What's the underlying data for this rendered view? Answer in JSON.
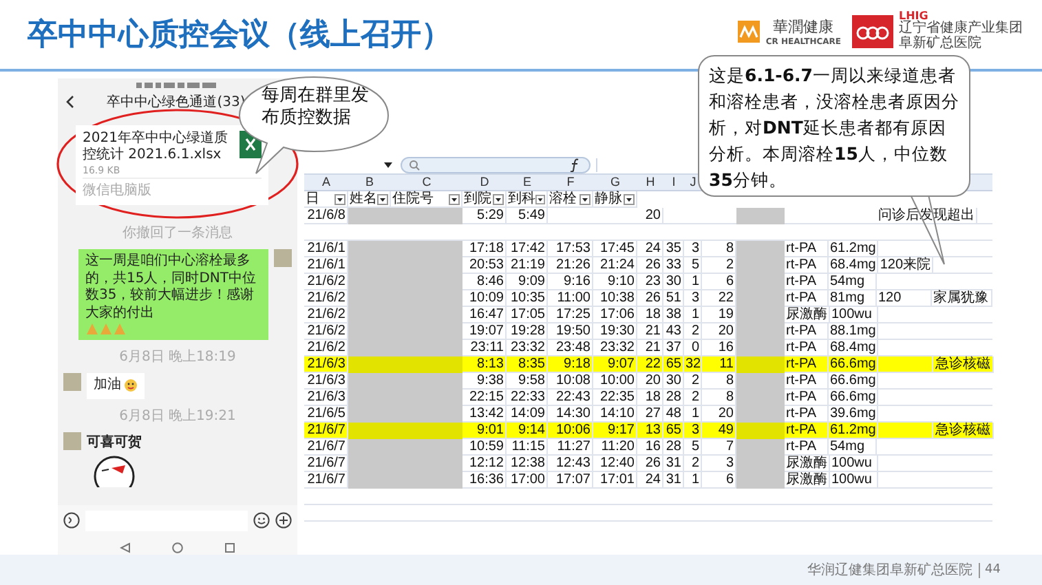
{
  "title": "卒中中心质控会议（线上召开）",
  "logos": {
    "cr": {
      "name": "華潤健康",
      "subtitle": "CR HEALTHCARE"
    },
    "lhig": {
      "abbr": "LHIG",
      "group": "辽宁省健康产业集团",
      "hospital": "阜新矿总医院"
    }
  },
  "phone": {
    "chat_title": "卒中中心绿色通道(33)",
    "messages": [
      {
        "kind": "file",
        "name": "2021年卒中中心绿道质控统计 2021.6.1.xlsx",
        "size": "16.9 KB",
        "source": "微信电脑版"
      },
      {
        "kind": "notice",
        "text": "你撤回了一条消息"
      },
      {
        "kind": "outgoing",
        "text": "这一周是咱们中心溶栓最多的，共15人，同时DNT中位数35，较前大幅进步！感谢大家的付出"
      },
      {
        "kind": "notice",
        "text": "6月8日 晚上18:19"
      },
      {
        "kind": "incoming",
        "text": "加油"
      },
      {
        "kind": "notice",
        "text": "6月8日 晚上19:21"
      },
      {
        "kind": "sticker",
        "text": "可喜可贺"
      }
    ]
  },
  "callouts": [
    {
      "text": "每周在群里发布质控数据"
    },
    {
      "text": "这是**6.1-6.7**一周以来绿道患者和溶栓患者，没溶栓患者原因分析，对**DNT**延长患者都有原因分析。本周溶栓**15**人，中位数**35**分钟。"
    }
  ],
  "sheet": {
    "columns": [
      {
        "letter": "A",
        "header": "日",
        "kind": "date"
      },
      {
        "letter": "B",
        "header": "姓名",
        "kind": "redacted"
      },
      {
        "letter": "C",
        "header": "住院号",
        "kind": "redacted"
      },
      {
        "letter": "D",
        "header": "到院",
        "kind": "number"
      },
      {
        "letter": "E",
        "header": "到科",
        "kind": "number"
      },
      {
        "letter": "F",
        "header": "溶栓",
        "kind": "number"
      },
      {
        "letter": "G",
        "header": "静脉",
        "kind": "number"
      },
      {
        "letter": "H",
        "kind": "number"
      },
      {
        "letter": "I",
        "kind": "number"
      },
      {
        "letter": "J",
        "kind": "number"
      },
      {
        "kind": "number"
      },
      {
        "kind": "redacted"
      },
      {
        "kind": "text"
      },
      {
        "kind": "text"
      },
      {
        "kind": "text"
      },
      {
        "kind": "text"
      }
    ],
    "rows": [
      {
        "highlighted": false,
        "cells": [
          "21/6/8",
          "",
          "",
          "5:29",
          "5:49",
          "",
          "",
          "20",
          "",
          "",
          "",
          "",
          "",
          "",
          "问诊后发现超出",
          ""
        ]
      },
      {
        "highlighted": false,
        "cells": [
          "21/6/1",
          "",
          "",
          "17:18",
          "17:42",
          "17:53",
          "17:45",
          "24",
          "35",
          "3",
          "8",
          "",
          "rt-PA",
          "61.2mg",
          "",
          ""
        ]
      },
      {
        "highlighted": false,
        "cells": [
          "21/6/1",
          "",
          "",
          "20:53",
          "21:19",
          "21:26",
          "21:24",
          "26",
          "33",
          "5",
          "2",
          "",
          "rt-PA",
          "68.4mg",
          "120来院",
          ""
        ]
      },
      {
        "highlighted": false,
        "cells": [
          "21/6/2",
          "",
          "",
          "8:46",
          "9:09",
          "9:16",
          "9:10",
          "23",
          "30",
          "1",
          "6",
          "",
          "rt-PA",
          "54mg",
          "",
          ""
        ]
      },
      {
        "highlighted": false,
        "cells": [
          "21/6/2",
          "",
          "",
          "10:09",
          "10:35",
          "11:00",
          "10:38",
          "26",
          "51",
          "3",
          "22",
          "",
          "rt-PA",
          "81mg",
          "120",
          "家属犹豫"
        ]
      },
      {
        "highlighted": false,
        "cells": [
          "21/6/2",
          "",
          "",
          "16:47",
          "17:05",
          "17:25",
          "17:06",
          "18",
          "38",
          "1",
          "19",
          "",
          "尿激酶",
          "100wu",
          "",
          ""
        ]
      },
      {
        "highlighted": false,
        "cells": [
          "21/6/2",
          "",
          "",
          "19:07",
          "19:28",
          "19:50",
          "19:30",
          "21",
          "43",
          "2",
          "20",
          "",
          "rt-PA",
          "88.1mg",
          "",
          ""
        ]
      },
      {
        "highlighted": false,
        "cells": [
          "21/6/2",
          "",
          "",
          "23:11",
          "23:32",
          "23:48",
          "23:32",
          "21",
          "37",
          "0",
          "16",
          "",
          "rt-PA",
          "68.4mg",
          "",
          ""
        ]
      },
      {
        "highlighted": true,
        "cells": [
          "21/6/3",
          "",
          "",
          "8:13",
          "8:35",
          "9:18",
          "9:07",
          "22",
          "65",
          "32",
          "11",
          "",
          "rt-PA",
          "66.6mg",
          "",
          "急诊核磁"
        ]
      },
      {
        "highlighted": false,
        "cells": [
          "21/6/3",
          "",
          "",
          "9:38",
          "9:58",
          "10:08",
          "10:00",
          "20",
          "30",
          "2",
          "8",
          "",
          "rt-PA",
          "66.6mg",
          "",
          ""
        ]
      },
      {
        "highlighted": false,
        "cells": [
          "21/6/3",
          "",
          "",
          "22:15",
          "22:33",
          "22:43",
          "22:35",
          "18",
          "28",
          "2",
          "8",
          "",
          "rt-PA",
          "66.6mg",
          "",
          ""
        ]
      },
      {
        "highlighted": false,
        "cells": [
          "21/6/5",
          "",
          "",
          "13:42",
          "14:09",
          "14:30",
          "14:10",
          "27",
          "48",
          "1",
          "20",
          "",
          "rt-PA",
          "39.6mg",
          "",
          ""
        ]
      },
      {
        "highlighted": true,
        "cells": [
          "21/6/7",
          "",
          "",
          "9:01",
          "9:14",
          "10:06",
          "9:17",
          "13",
          "65",
          "3",
          "49",
          "",
          "rt-PA",
          "61.2mg",
          "",
          "急诊核磁"
        ]
      },
      {
        "highlighted": false,
        "cells": [
          "21/6/7",
          "",
          "",
          "10:59",
          "11:15",
          "11:27",
          "11:20",
          "16",
          "28",
          "5",
          "7",
          "",
          "rt-PA",
          "54mg",
          "",
          ""
        ]
      },
      {
        "highlighted": false,
        "cells": [
          "21/6/7",
          "",
          "",
          "12:12",
          "12:38",
          "12:43",
          "12:40",
          "26",
          "31",
          "2",
          "3",
          "",
          "尿激酶",
          "100wu",
          "",
          ""
        ]
      },
      {
        "highlighted": false,
        "cells": [
          "21/6/7",
          "",
          "",
          "16:36",
          "17:00",
          "17:07",
          "17:01",
          "24",
          "31",
          "1",
          "6",
          "",
          "尿激酶",
          "100wu",
          "",
          ""
        ]
      }
    ]
  },
  "footer": {
    "org": "华润辽健集团阜新矿总医院",
    "page": "44"
  }
}
